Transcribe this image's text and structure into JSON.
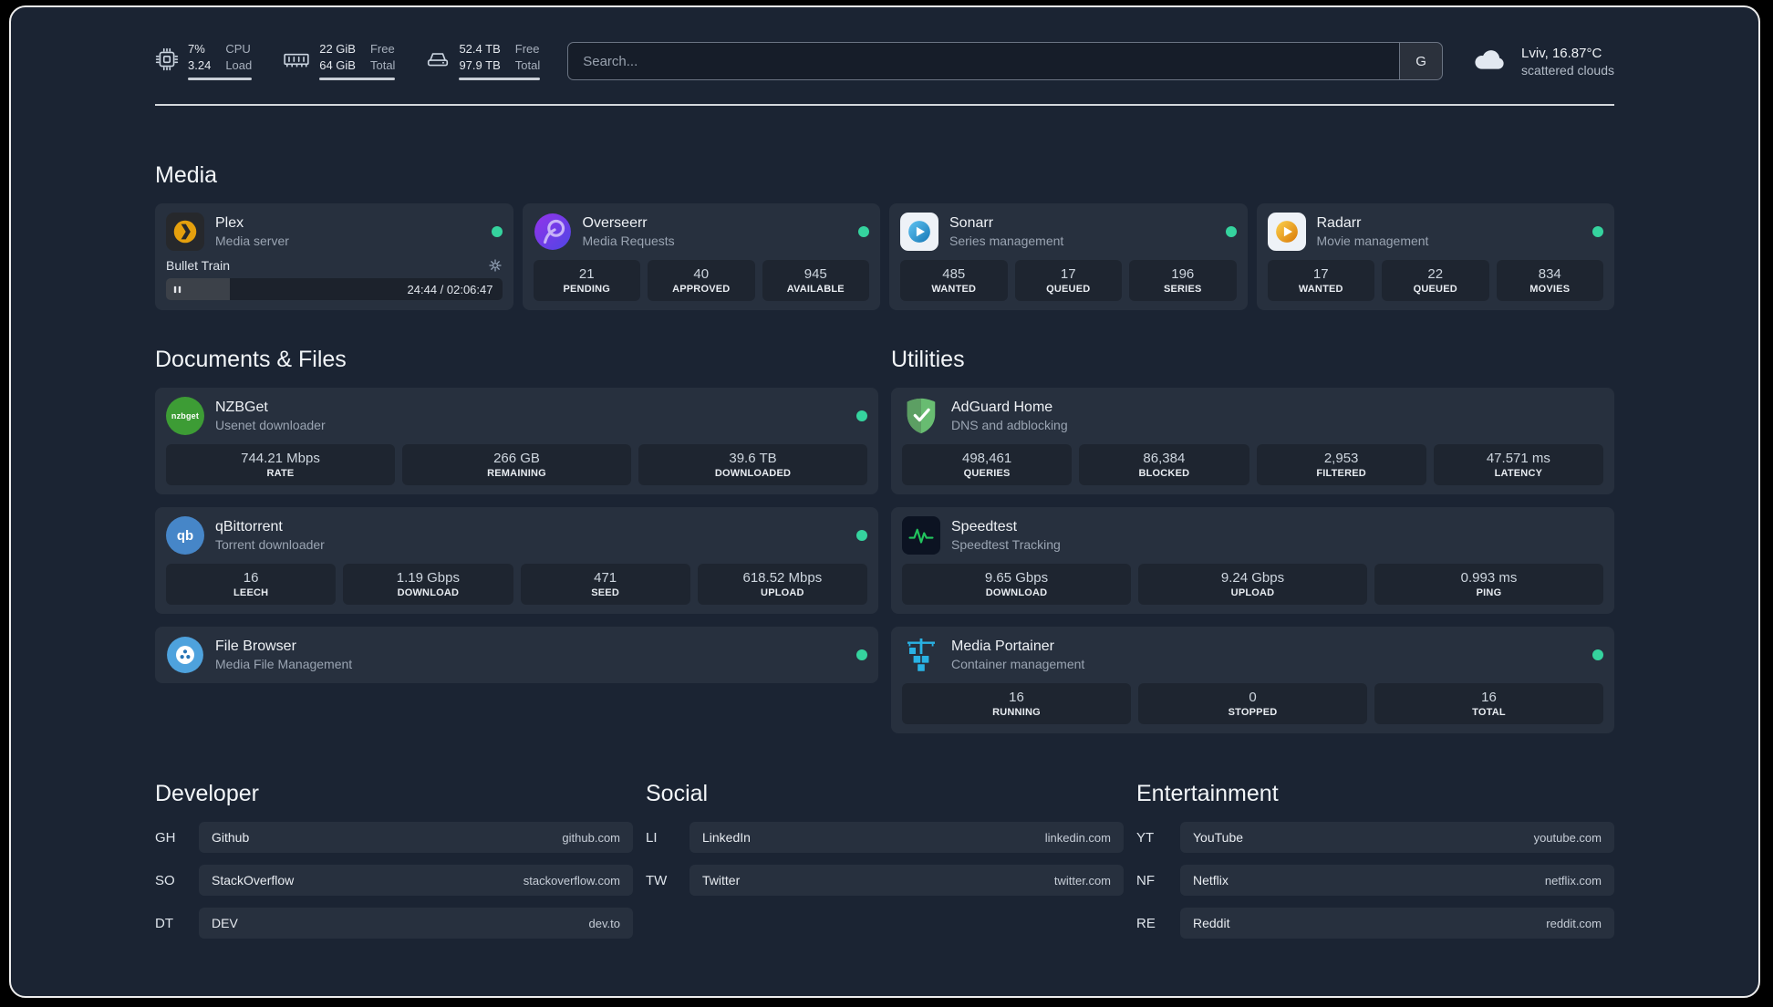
{
  "theme": {
    "page_background": "#1b2433",
    "status_online": "#35d39e",
    "divider": "#dde1e6"
  },
  "topbar": {
    "resources": [
      {
        "icon": "cpu-icon",
        "values": [
          "7%",
          "3.24"
        ],
        "labels": [
          "CPU",
          "Load"
        ]
      },
      {
        "icon": "memory-icon",
        "values": [
          "22 GiB",
          "64 GiB"
        ],
        "labels": [
          "Free",
          "Total"
        ]
      },
      {
        "icon": "disk-icon",
        "values": [
          "52.4 TB",
          "97.9 TB"
        ],
        "labels": [
          "Free",
          "Total"
        ]
      }
    ],
    "search": {
      "placeholder": "Search...",
      "provider_button": "G"
    },
    "weather": {
      "location": "Lviv, 16.87°C",
      "condition": "scattered clouds"
    }
  },
  "sections": {
    "media": {
      "title": "Media",
      "services": [
        {
          "name": "Plex",
          "subtitle": "Media server",
          "icon": "plex-icon",
          "player": {
            "track": "Bullet Train",
            "time": "24:44 / 02:06:47",
            "progress_percent": 19
          }
        },
        {
          "name": "Overseerr",
          "subtitle": "Media Requests",
          "icon": "overseerr-icon",
          "stats": [
            {
              "value": "21",
              "label": "PENDING"
            },
            {
              "value": "40",
              "label": "APPROVED"
            },
            {
              "value": "945",
              "label": "AVAILABLE"
            }
          ]
        },
        {
          "name": "Sonarr",
          "subtitle": "Series management",
          "icon": "sonarr-icon",
          "stats": [
            {
              "value": "485",
              "label": "WANTED"
            },
            {
              "value": "17",
              "label": "QUEUED"
            },
            {
              "value": "196",
              "label": "SERIES"
            }
          ]
        },
        {
          "name": "Radarr",
          "subtitle": "Movie management",
          "icon": "radarr-icon",
          "stats": [
            {
              "value": "17",
              "label": "WANTED"
            },
            {
              "value": "22",
              "label": "QUEUED"
            },
            {
              "value": "834",
              "label": "MOVIES"
            }
          ]
        }
      ]
    },
    "documents": {
      "title": "Documents & Files",
      "services": [
        {
          "name": "NZBGet",
          "subtitle": "Usenet downloader",
          "icon": "nzbget-icon",
          "icon_text": "nzbget",
          "stats": [
            {
              "value": "744.21 Mbps",
              "label": "RATE"
            },
            {
              "value": "266 GB",
              "label": "REMAINING"
            },
            {
              "value": "39.6 TB",
              "label": "DOWNLOADED"
            }
          ]
        },
        {
          "name": "qBittorrent",
          "subtitle": "Torrent downloader",
          "icon": "qbittorrent-icon",
          "icon_text": "qb",
          "stats": [
            {
              "value": "16",
              "label": "LEECH"
            },
            {
              "value": "1.19 Gbps",
              "label": "DOWNLOAD"
            },
            {
              "value": "471",
              "label": "SEED"
            },
            {
              "value": "618.52 Mbps",
              "label": "UPLOAD"
            }
          ]
        },
        {
          "name": "File Browser",
          "subtitle": "Media File Management",
          "icon": "filebrowser-icon"
        }
      ]
    },
    "utilities": {
      "title": "Utilities",
      "services": [
        {
          "name": "AdGuard Home",
          "subtitle": "DNS and adblocking",
          "icon": "adguard-icon",
          "stats": [
            {
              "value": "498,461",
              "label": "QUERIES"
            },
            {
              "value": "86,384",
              "label": "BLOCKED"
            },
            {
              "value": "2,953",
              "label": "FILTERED"
            },
            {
              "value": "47.571 ms",
              "label": "LATENCY"
            }
          ]
        },
        {
          "name": "Speedtest",
          "subtitle": "Speedtest Tracking",
          "icon": "speedtest-icon",
          "stats": [
            {
              "value": "9.65 Gbps",
              "label": "DOWNLOAD"
            },
            {
              "value": "9.24 Gbps",
              "label": "UPLOAD"
            },
            {
              "value": "0.993 ms",
              "label": "PING"
            }
          ]
        },
        {
          "name": "Media Portainer",
          "subtitle": "Container management",
          "icon": "portainer-icon",
          "stats": [
            {
              "value": "16",
              "label": "RUNNING"
            },
            {
              "value": "0",
              "label": "STOPPED"
            },
            {
              "value": "16",
              "label": "TOTAL"
            }
          ]
        }
      ]
    }
  },
  "bookmarks": {
    "developer": {
      "title": "Developer",
      "items": [
        {
          "abbr": "GH",
          "name": "Github",
          "url": "github.com"
        },
        {
          "abbr": "SO",
          "name": "StackOverflow",
          "url": "stackoverflow.com"
        },
        {
          "abbr": "DT",
          "name": "DEV",
          "url": "dev.to"
        }
      ]
    },
    "social": {
      "title": "Social",
      "items": [
        {
          "abbr": "LI",
          "name": "LinkedIn",
          "url": "linkedin.com"
        },
        {
          "abbr": "TW",
          "name": "Twitter",
          "url": "twitter.com"
        }
      ]
    },
    "entertainment": {
      "title": "Entertainment",
      "items": [
        {
          "abbr": "YT",
          "name": "YouTube",
          "url": "youtube.com"
        },
        {
          "abbr": "NF",
          "name": "Netflix",
          "url": "netflix.com"
        },
        {
          "abbr": "RE",
          "name": "Reddit",
          "url": "reddit.com"
        }
      ]
    }
  }
}
